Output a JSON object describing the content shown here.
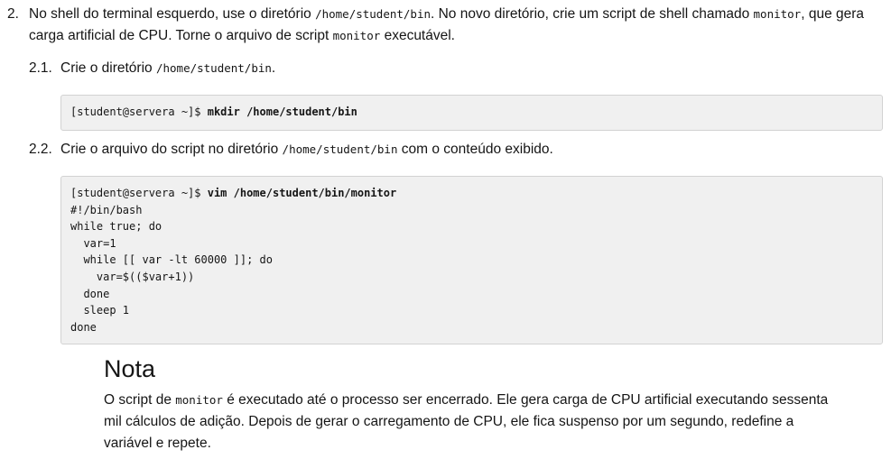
{
  "step2": {
    "number": "2.",
    "text_a": "No shell do terminal esquerdo, use o diretório ",
    "code_a": "/home/student/bin",
    "text_b": ". No novo diretório, crie um script de shell chamado ",
    "code_b": "monitor",
    "text_c": ", que gera carga artificial de CPU. Torne o arquivo de script ",
    "code_c": "monitor",
    "text_d": " executável."
  },
  "substep_1": {
    "number": "2.1.",
    "text_a": "Crie o diretório ",
    "code_a": "/home/student/bin",
    "text_b": ".",
    "prompt": "[student@servera ~]$ ",
    "command": "mkdir /home/student/bin"
  },
  "substep_2": {
    "number": "2.2.",
    "text_a": "Crie o arquivo do script no diretório ",
    "code_a": "/home/student/bin",
    "text_b": " com o conteúdo exibido.",
    "prompt": "[student@servera ~]$ ",
    "command": "vim /home/student/bin/monitor",
    "script_lines": [
      "#!/bin/bash",
      "while true; do",
      "  var=1",
      "  while [[ var -lt 60000 ]]; do",
      "    var=$(($var+1))",
      "  done",
      "  sleep 1",
      "done"
    ]
  },
  "note": {
    "title": "Nota",
    "text_a": "O script de ",
    "code_a": "monitor",
    "text_b": " é executado até o processo ser encerrado. Ele gera carga de CPU artificial executando sessenta mil cálculos de adição. Depois de gerar o carregamento de CPU, ele fica suspenso por um segundo, redefine a variável e repete."
  }
}
